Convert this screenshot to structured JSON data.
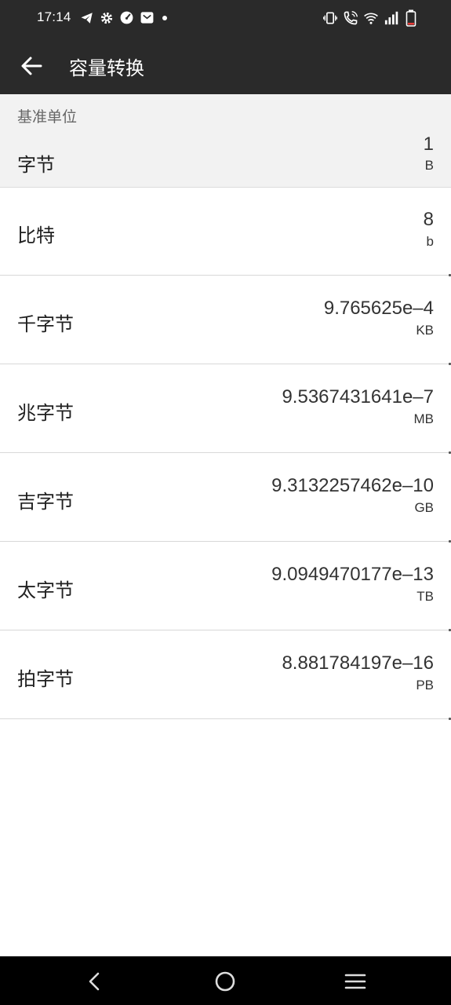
{
  "status_bar": {
    "time": "17:14",
    "left_icons": [
      "telegram-icon",
      "gear-icon",
      "speed-icon",
      "mail-icon",
      "dot-icon"
    ],
    "right_icons": [
      "vibrate-icon",
      "wifi-calling-icon",
      "wifi-icon",
      "signal-icon",
      "battery-icon"
    ],
    "battery_level": 0.15
  },
  "app_bar": {
    "title": "容量转换"
  },
  "base_unit": {
    "section_label": "基准单位",
    "name": "字节",
    "value": "1",
    "unit": "B"
  },
  "units": [
    {
      "name": "比特",
      "value": "8",
      "unit": "b"
    },
    {
      "name": "千字节",
      "value": "9.765625e–4",
      "unit": "KB"
    },
    {
      "name": "兆字节",
      "value": "9.5367431641e–7",
      "unit": "MB"
    },
    {
      "name": "吉字节",
      "value": "9.3132257462e–10",
      "unit": "GB"
    },
    {
      "name": "太字节",
      "value": "9.0949470177e–13",
      "unit": "TB"
    },
    {
      "name": "拍字节",
      "value": "8.881784197e–16",
      "unit": "PB"
    }
  ],
  "nav_bar": {
    "buttons": [
      "back-nav-icon",
      "home-nav-icon",
      "recents-nav-icon"
    ]
  },
  "colors": {
    "app_bar_bg": "#2a2a2a",
    "base_section_bg": "#f2f2f2",
    "nav_bar_bg": "#000000"
  }
}
